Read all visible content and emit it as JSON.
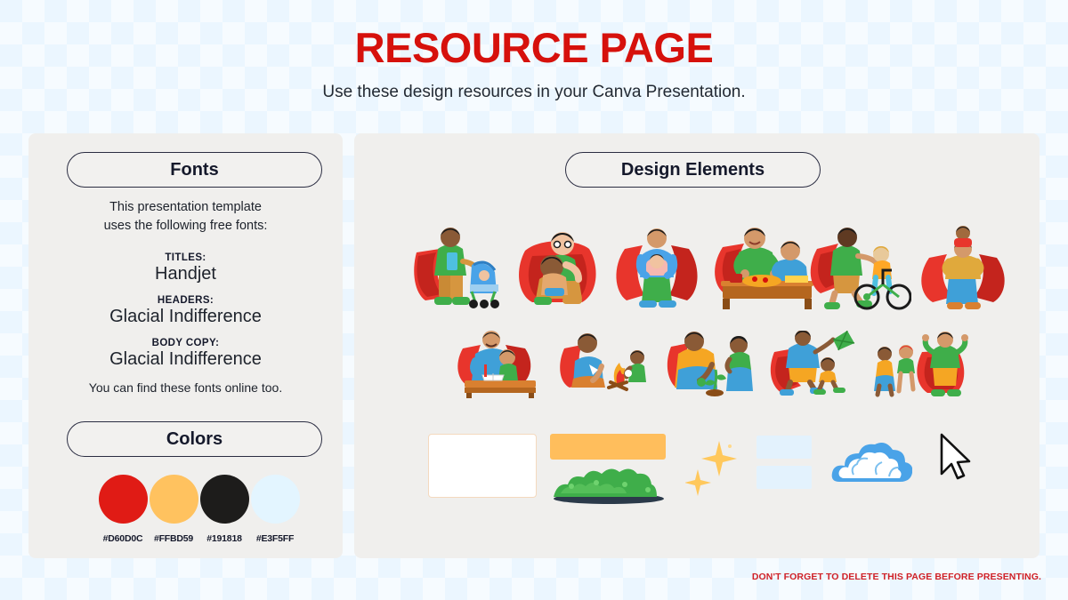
{
  "header": {
    "title": "RESOURCE PAGE",
    "subtitle": "Use these design resources in your Canva Presentation.",
    "title_color": "#D6110C"
  },
  "fonts_panel": {
    "pill_label": "Fonts",
    "intro": "This presentation template\nuses the following free fonts:",
    "intro_line_1": "This presentation template",
    "intro_line_2": "uses the following free fonts:",
    "rows": [
      {
        "kicker": "TITLES:",
        "sample": "Handjet"
      },
      {
        "kicker": "HEADERS:",
        "sample": "Glacial Indifference"
      },
      {
        "kicker": "BODY COPY:",
        "sample": "Glacial Indifference"
      }
    ],
    "outro": "You can find these fonts online too."
  },
  "colors_panel": {
    "pill_label": "Colors",
    "swatches": [
      {
        "hex_label": "#D60D0C",
        "color": "#e01b15"
      },
      {
        "hex_label": "#FFBD59",
        "color": "#ffc25f"
      },
      {
        "hex_label": "#191818",
        "color": "#1d1c1b"
      },
      {
        "hex_label": "#E3F5FF",
        "color": "#e3f5ff"
      }
    ]
  },
  "design_elements_panel": {
    "pill_label": "Design Elements",
    "illustration_rows": [
      [
        {
          "name": "superhero-dad-with-stroller"
        },
        {
          "name": "superhero-dad-hugging-child"
        },
        {
          "name": "superhero-dad-holding-baby"
        },
        {
          "name": "superhero-dad-eating-with-son"
        },
        {
          "name": "superhero-dad-teaching-bicycle"
        },
        {
          "name": "superhero-dad-child-on-shoulders"
        }
      ],
      [
        {
          "name": "dad-reading-with-child-at-desk"
        },
        {
          "name": "dad-and-child-at-campfire"
        },
        {
          "name": "parents-planting-with-daughter"
        },
        {
          "name": "dad-flying-kite-with-child"
        },
        {
          "name": "dad-cheering-with-family"
        }
      ]
    ],
    "graphic_elements": [
      {
        "name": "white-card",
        "color": "#ffffff",
        "border": "#f4d9be"
      },
      {
        "name": "orange-bar",
        "color": "#ffbe5c"
      },
      {
        "name": "green-bush",
        "color": "#3fae4a"
      },
      {
        "name": "sparkles",
        "color": "#ffc85c"
      },
      {
        "name": "light-blue-rectangles",
        "color": "#e3f2fd"
      },
      {
        "name": "cloud",
        "color": "#4aa3e8"
      },
      {
        "name": "cursor-arrow",
        "color": "#111111"
      }
    ]
  },
  "footer": {
    "note": "DON'T FORGET TO DELETE THIS PAGE BEFORE PRESENTING.",
    "color": "#cf2026"
  }
}
